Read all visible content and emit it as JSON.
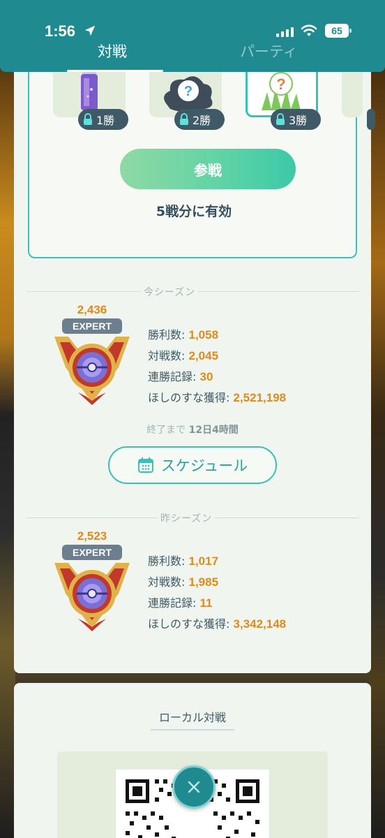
{
  "status_bar": {
    "time": "1:56",
    "battery": "65",
    "icons": [
      "location-arrow-icon",
      "signal-icon",
      "wifi-icon",
      "battery-icon"
    ]
  },
  "tabs": [
    {
      "label": "対戦",
      "active": true
    },
    {
      "label": "パーティ",
      "active": false
    }
  ],
  "rewards": [
    {
      "icon": "potion-icon",
      "label": "1勝"
    },
    {
      "icon": "mystery-cloud-icon",
      "label": "2勝"
    },
    {
      "icon": "mystery-grass-icon",
      "label": "3勝"
    }
  ],
  "join_button": "参戦",
  "valid_text": "5戦分に有効",
  "current_season": {
    "label": "今シーズン",
    "rating": "2,436",
    "rank": "EXPERT",
    "stats": [
      {
        "label": "勝利数: ",
        "value": "1,058"
      },
      {
        "label": "対戦数: ",
        "value": "2,045"
      },
      {
        "label": "連勝記録: ",
        "value": "30"
      },
      {
        "label": "ほしのすな獲得: ",
        "value": "2,521,198"
      }
    ],
    "end_prefix": "終了まで ",
    "end_value": "12日4時間"
  },
  "schedule_button": "スケジュール",
  "last_season": {
    "label": "昨シーズン",
    "rating": "2,523",
    "rank": "EXPERT",
    "stats": [
      {
        "label": "勝利数: ",
        "value": "1,017"
      },
      {
        "label": "対戦数: ",
        "value": "1,985"
      },
      {
        "label": "連勝記録: ",
        "value": "11"
      },
      {
        "label": "ほしのすな獲得: ",
        "value": "3,342,148"
      }
    ]
  },
  "local_battle": {
    "title": "ローカル対戦"
  },
  "colors": {
    "header": "#1f8a8f",
    "accent": "#39c0b9",
    "orange": "#e08a1b",
    "text": "#3d5a66"
  }
}
